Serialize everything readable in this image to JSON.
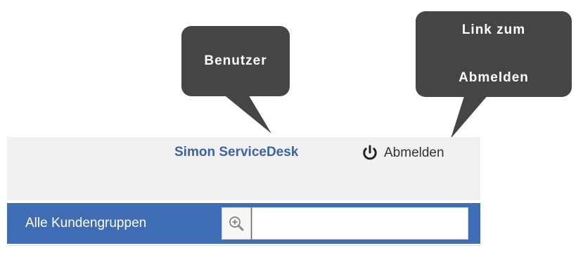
{
  "callouts": {
    "user": "Benutzer",
    "logout_line1": "Link zum",
    "logout_line2": "Abmelden"
  },
  "header": {
    "user_name": "Simon ServiceDesk",
    "logout_label": "Abmelden"
  },
  "customer_groups": {
    "label": "Alle Kundengruppen",
    "search_value": "",
    "search_icon": "zoom-in-icon"
  },
  "colors": {
    "brand_blue": "#3e6db5",
    "user_link": "#3a63a8",
    "callout_bg": "#454545",
    "header_bg": "#f1f1f1"
  }
}
